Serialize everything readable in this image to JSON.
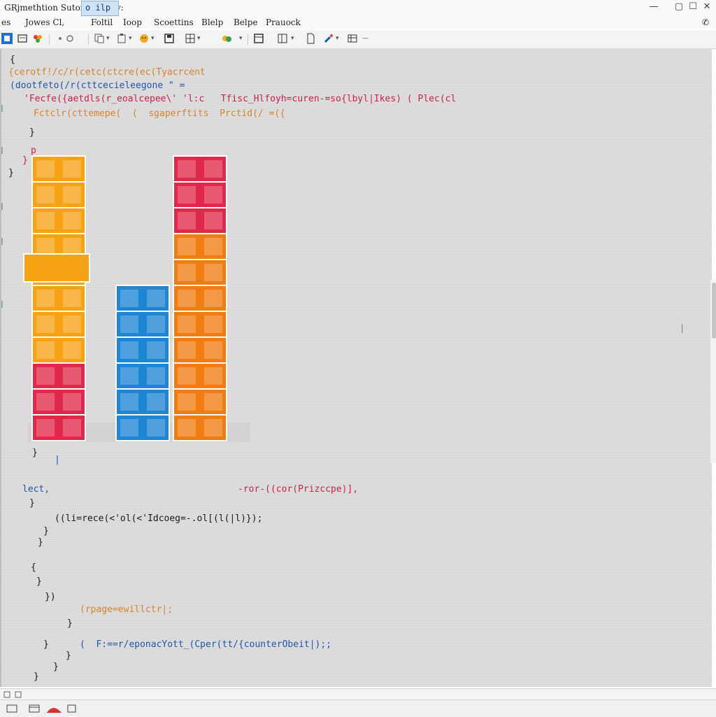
{
  "window": {
    "title": "GRjmethtion Suton SorDEy:",
    "controls": [
      "—",
      "▢",
      "☐",
      "✕"
    ]
  },
  "menu": {
    "items": [
      "es",
      "Jowes Cl,",
      "Foltil",
      "Ioop",
      "Scoettins",
      "Blelp",
      "Belpe",
      "Prauock"
    ],
    "right_glyph": "✆"
  },
  "code": {
    "lines": [
      "{",
      "{cerotf!/c/r(cetc(ctcre(ec(Tyacrcent",
      "(dootfeto(/r(cttcecieleegone \" =",
      "'Fecfe({aetdls(r_eoalcepee\\' 'l:c   Tfisc_Hlfoyh=curen-=so{lbyl|Ikes) ( Plec(cl",
      "Fctclr(cttemepe(  (  sgaperftits  Prctid(/ =({",
      "}",
      "p",
      "}",
      "}",
      "|",
      "}",
      "lect,",
      "-ror-((cor(Prizccpe)],",
      "}",
      "((li=rece(<'ol(<'Idcoeg=-.ol[(l(|l)});",
      "}",
      "}",
      "{",
      "}",
      "})",
      "(rpage=ewillctr|;",
      "}",
      "(  F:==r/eponacYott_(Cper(tt/{counterObeit|);;",
      "}",
      "}",
      "}",
      "}"
    ]
  },
  "colors": {
    "orange_block": "#f5a214",
    "red_block": "#e0294a",
    "blue_block": "#1f86d4",
    "deep_orange_block": "#f07d14",
    "code_orange": "#d9822b",
    "code_red": "#cc1f4b",
    "code_dark": "#1a1a1a",
    "code_blue": "#1e56b0"
  },
  "chart_data": {
    "type": "bar",
    "categories": [
      "",
      "",
      ""
    ],
    "series": [
      {
        "values": [
          11,
          6,
          11
        ]
      }
    ]
  },
  "taskbar": {
    "active_label": "o ilp"
  }
}
